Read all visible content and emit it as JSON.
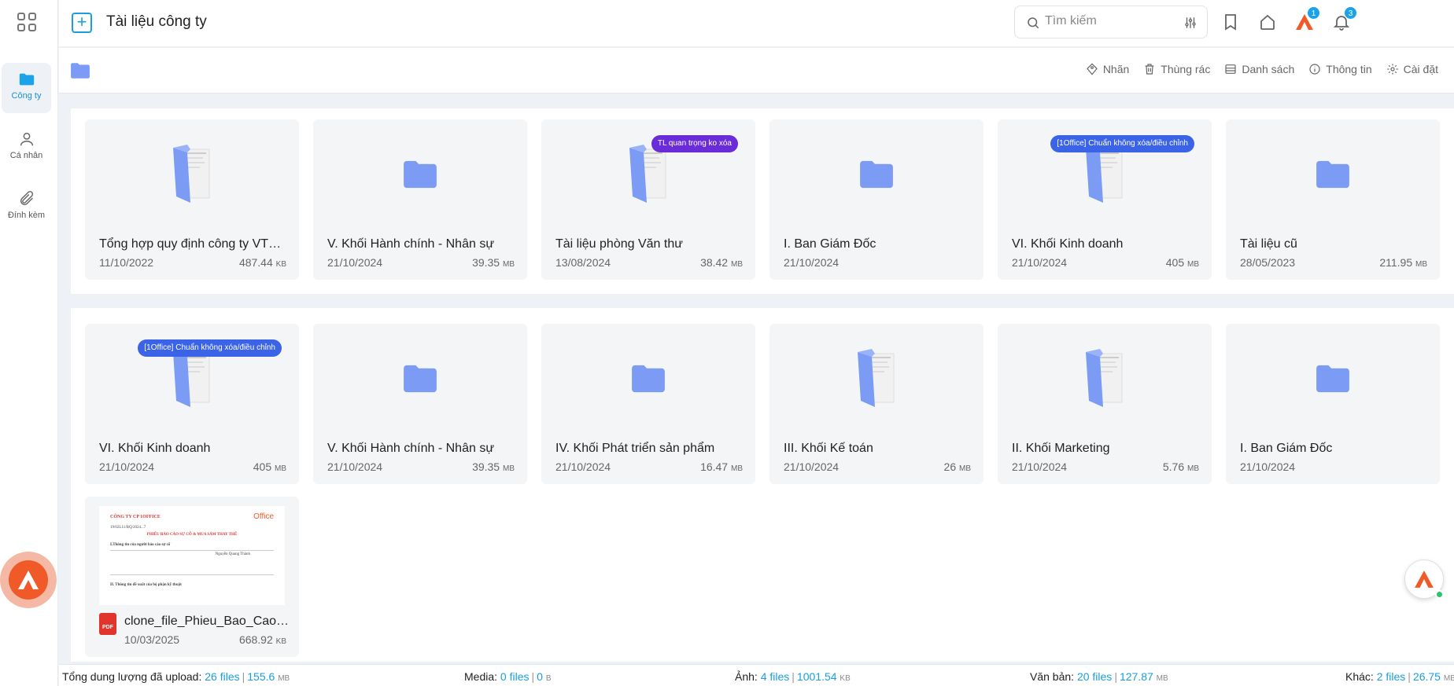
{
  "app": {
    "title": "Tài liệu công ty"
  },
  "sidebar": {
    "items": [
      {
        "label": "Công ty",
        "icon": "folder-icon",
        "active": true
      },
      {
        "label": "Cá nhân",
        "icon": "user-icon"
      },
      {
        "label": "Đính kèm",
        "icon": "paperclip-icon"
      }
    ]
  },
  "search": {
    "placeholder": "Tìm kiếm"
  },
  "header": {
    "badges": {
      "brand": "1",
      "notifications": "3"
    }
  },
  "toolbar": {
    "actions": [
      "Nhãn",
      "Thùng rác",
      "Danh sách",
      "Thông tin",
      "Cài đặt"
    ]
  },
  "section1": {
    "cards": [
      {
        "name": "Tổng hợp quy định công ty VTC ...",
        "date": "11/10/2022",
        "size": "487.44",
        "unit": "KB",
        "thumb": "document-folder"
      },
      {
        "name": "V. Khối Hành chính - Nhân sự",
        "date": "21/10/2024",
        "size": "39.35",
        "unit": "MB",
        "thumb": "folder"
      },
      {
        "name": "Tài liệu phòng Văn thư",
        "date": "13/08/2024",
        "size": "38.42",
        "unit": "MB",
        "thumb": "document-folder",
        "tag": "TL quan trọng ko xóa"
      },
      {
        "name": "I. Ban Giám Đốc",
        "date": "21/10/2024",
        "size": "",
        "unit": "",
        "thumb": "folder"
      },
      {
        "name": "VI. Khối Kinh doanh",
        "date": "21/10/2024",
        "size": "405",
        "unit": "MB",
        "thumb": "document-folder",
        "tag": "[1Office] Chuẩn không xóa/điều chỉnh"
      },
      {
        "name": "Tài liệu cũ",
        "date": "28/05/2023",
        "size": "211.95",
        "unit": "MB",
        "thumb": "folder"
      }
    ]
  },
  "section2": {
    "cards": [
      {
        "name": "VI. Khối Kinh doanh",
        "date": "21/10/2024",
        "size": "405",
        "unit": "MB",
        "thumb": "document-folder",
        "tag": "[1Office] Chuẩn không xóa/điều chỉnh"
      },
      {
        "name": "V. Khối Hành chính - Nhân sự",
        "date": "21/10/2024",
        "size": "39.35",
        "unit": "MB",
        "thumb": "folder"
      },
      {
        "name": "IV. Khối Phát triển sản phẩm",
        "date": "21/10/2024",
        "size": "16.47",
        "unit": "MB",
        "thumb": "folder"
      },
      {
        "name": "III. Khối Kế toán",
        "date": "21/10/2024",
        "size": "26",
        "unit": "MB",
        "thumb": "document-folder"
      },
      {
        "name": "II. Khối Marketing",
        "date": "21/10/2024",
        "size": "5.76",
        "unit": "MB",
        "thumb": "document-folder"
      },
      {
        "name": "I. Ban Giám Đốc",
        "date": "21/10/2024",
        "size": "",
        "unit": "",
        "thumb": "folder"
      }
    ],
    "file": {
      "name": "clone_file_Phieu_Bao_Cao_S...",
      "date": "10/03/2025",
      "size": "668.92",
      "unit": "KB",
      "type_badge": "PDF",
      "preview": {
        "company": "CÔNG TY CP 1OFFICE",
        "logo": "Office",
        "title": "PHIẾU BÁO CÁO SỰ CỐ & MUA SẮM THAY THẾ",
        "section1": "I.Thông tin của người báo cáo sự cố",
        "section2": "II. Thông tin đề xuất của bộ phận kỹ thuật",
        "code_line": "19/02L11/BQ/2024...7",
        "person": "Nguyễn Quang Thành"
      }
    }
  },
  "footer": {
    "total": {
      "label": "Tổng dung lượng đã upload:",
      "files": "26 files",
      "size": "155.6",
      "unit": "MB"
    },
    "media": {
      "label": "Media:",
      "files": "0 files",
      "size": "0",
      "unit": "B"
    },
    "images": {
      "label": "Ảnh:",
      "files": "4 files",
      "size": "1001.54",
      "unit": "KB"
    },
    "documents": {
      "label": "Văn bản:",
      "files": "20 files",
      "size": "127.87",
      "unit": "MB"
    },
    "other": {
      "label": "Khác:",
      "files": "2 files",
      "size": "26.75",
      "unit": "MB"
    }
  },
  "colors": {
    "accent": "#1a9ee0",
    "brand": "#f05a28",
    "folder": "#7b9bf5",
    "tag_purple": "#6a2bd9",
    "tag_blue": "#3b63e8"
  }
}
